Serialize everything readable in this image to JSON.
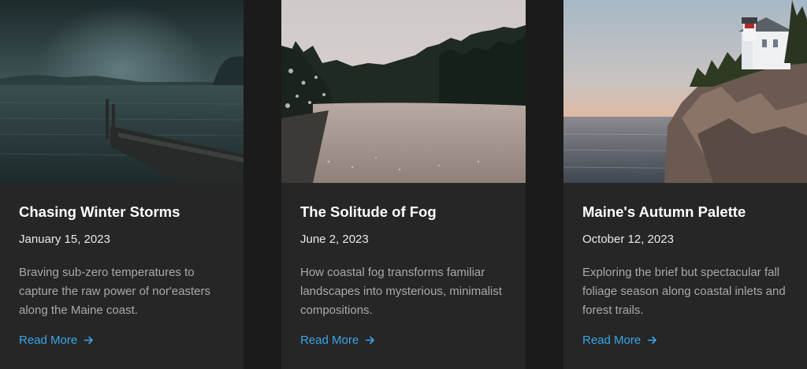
{
  "cards": [
    {
      "title": "Chasing Winter Storms",
      "date": "January 15, 2023",
      "description": "Braving sub-zero temperatures to capture the raw power of nor'easters along the Maine coast.",
      "link_label": "Read More",
      "link_icon": "arrow-right-icon",
      "image": "foggy-lake-with-dock"
    },
    {
      "title": "The Solitude of Fog",
      "date": "June 2, 2023",
      "description": "How coastal fog transforms familiar landscapes into mysterious, minimalist compositions.",
      "link_label": "Read More",
      "link_icon": "arrow-right-icon",
      "image": "snowy-forest-frozen-pond"
    },
    {
      "title": "Maine's Autumn Palette",
      "date": "October 12, 2023",
      "description": "Exploring the brief but spectacular fall foliage season along coastal inlets and forest trails.",
      "link_label": "Read More",
      "link_icon": "arrow-right-icon",
      "image": "lighthouse-rocky-coast-sunset"
    }
  ],
  "colors": {
    "page_background": "#1b1b1b",
    "card_background": "#262626",
    "title": "#ffffff",
    "date": "#e8e8e8",
    "description": "#a9a9a9",
    "link": "#3aa6e8"
  }
}
